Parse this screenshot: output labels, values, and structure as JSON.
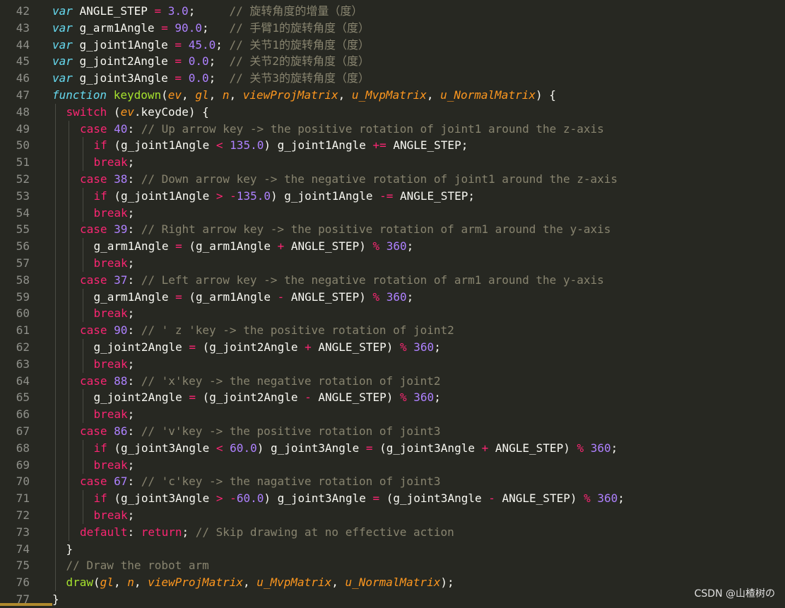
{
  "editor": {
    "lines": [
      {
        "n": "42",
        "indent": 0,
        "tokens": [
          [
            "kw",
            "var"
          ],
          [
            "var",
            " ANGLE_STEP "
          ],
          [
            "op",
            "="
          ],
          [
            "var",
            " "
          ],
          [
            "num",
            "3.0"
          ],
          [
            "var",
            ";     "
          ],
          [
            "cm",
            "// 旋转角度的增量（度）"
          ]
        ]
      },
      {
        "n": "43",
        "indent": 0,
        "tokens": [
          [
            "kw",
            "var"
          ],
          [
            "var",
            " g_arm1Angle "
          ],
          [
            "op",
            "="
          ],
          [
            "var",
            " "
          ],
          [
            "num",
            "90.0"
          ],
          [
            "var",
            ";   "
          ],
          [
            "cm",
            "// 手臂1的旋转角度（度）"
          ]
        ]
      },
      {
        "n": "44",
        "indent": 0,
        "tokens": [
          [
            "kw",
            "var"
          ],
          [
            "var",
            " g_joint1Angle "
          ],
          [
            "op",
            "="
          ],
          [
            "var",
            " "
          ],
          [
            "num",
            "45.0"
          ],
          [
            "var",
            "; "
          ],
          [
            "cm",
            "// 关节1的旋转角度（度）"
          ]
        ]
      },
      {
        "n": "45",
        "indent": 0,
        "tokens": [
          [
            "kw",
            "var"
          ],
          [
            "var",
            " g_joint2Angle "
          ],
          [
            "op",
            "="
          ],
          [
            "var",
            " "
          ],
          [
            "num",
            "0.0"
          ],
          [
            "var",
            ";  "
          ],
          [
            "cm",
            "// 关节2的旋转角度（度）"
          ]
        ]
      },
      {
        "n": "46",
        "indent": 0,
        "tokens": [
          [
            "kw",
            "var"
          ],
          [
            "var",
            " g_joint3Angle "
          ],
          [
            "op",
            "="
          ],
          [
            "var",
            " "
          ],
          [
            "num",
            "0.0"
          ],
          [
            "var",
            ";  "
          ],
          [
            "cm",
            "// 关节3的旋转角度（度）"
          ]
        ]
      },
      {
        "n": "47",
        "indent": 0,
        "tokens": [
          [
            "kw",
            "function"
          ],
          [
            "var",
            " "
          ],
          [
            "fn",
            "keydown"
          ],
          [
            "var",
            "("
          ],
          [
            "param",
            "ev"
          ],
          [
            "var",
            ", "
          ],
          [
            "param",
            "gl"
          ],
          [
            "var",
            ", "
          ],
          [
            "param",
            "n"
          ],
          [
            "var",
            ", "
          ],
          [
            "param",
            "viewProjMatrix"
          ],
          [
            "var",
            ", "
          ],
          [
            "param",
            "u_MvpMatrix"
          ],
          [
            "var",
            ", "
          ],
          [
            "param",
            "u_NormalMatrix"
          ],
          [
            "var",
            ") {"
          ]
        ]
      },
      {
        "n": "48",
        "indent": 1,
        "tokens": [
          [
            "kw2",
            "switch"
          ],
          [
            "var",
            " ("
          ],
          [
            "param",
            "ev"
          ],
          [
            "var",
            ".keyCode) {"
          ]
        ]
      },
      {
        "n": "49",
        "indent": 2,
        "tokens": [
          [
            "kw2",
            "case"
          ],
          [
            "var",
            " "
          ],
          [
            "num",
            "40"
          ],
          [
            "var",
            ": "
          ],
          [
            "cm",
            "// Up arrow key -> the positive rotation of joint1 around the z-axis"
          ]
        ]
      },
      {
        "n": "50",
        "indent": 3,
        "tokens": [
          [
            "kw2",
            "if"
          ],
          [
            "var",
            " (g_joint1Angle "
          ],
          [
            "op",
            "<"
          ],
          [
            "var",
            " "
          ],
          [
            "num",
            "135.0"
          ],
          [
            "var",
            ") g_joint1Angle "
          ],
          [
            "op",
            "+="
          ],
          [
            "var",
            " ANGLE_STEP;"
          ]
        ]
      },
      {
        "n": "51",
        "indent": 3,
        "tokens": [
          [
            "kw2",
            "break"
          ],
          [
            "var",
            ";"
          ]
        ]
      },
      {
        "n": "52",
        "indent": 2,
        "tokens": [
          [
            "kw2",
            "case"
          ],
          [
            "var",
            " "
          ],
          [
            "num",
            "38"
          ],
          [
            "var",
            ": "
          ],
          [
            "cm",
            "// Down arrow key -> the negative rotation of joint1 around the z-axis"
          ]
        ]
      },
      {
        "n": "53",
        "indent": 3,
        "tokens": [
          [
            "kw2",
            "if"
          ],
          [
            "var",
            " (g_joint1Angle "
          ],
          [
            "op",
            ">"
          ],
          [
            "var",
            " "
          ],
          [
            "op",
            "-"
          ],
          [
            "num",
            "135.0"
          ],
          [
            "var",
            ") g_joint1Angle "
          ],
          [
            "op",
            "-="
          ],
          [
            "var",
            " ANGLE_STEP;"
          ]
        ]
      },
      {
        "n": "54",
        "indent": 3,
        "tokens": [
          [
            "kw2",
            "break"
          ],
          [
            "var",
            ";"
          ]
        ]
      },
      {
        "n": "55",
        "indent": 2,
        "tokens": [
          [
            "kw2",
            "case"
          ],
          [
            "var",
            " "
          ],
          [
            "num",
            "39"
          ],
          [
            "var",
            ": "
          ],
          [
            "cm",
            "// Right arrow key -> the positive rotation of arm1 around the y-axis"
          ]
        ]
      },
      {
        "n": "56",
        "indent": 3,
        "tokens": [
          [
            "var",
            "g_arm1Angle "
          ],
          [
            "op",
            "="
          ],
          [
            "var",
            " (g_arm1Angle "
          ],
          [
            "op",
            "+"
          ],
          [
            "var",
            " ANGLE_STEP) "
          ],
          [
            "op",
            "%"
          ],
          [
            "var",
            " "
          ],
          [
            "num",
            "360"
          ],
          [
            "var",
            ";"
          ]
        ]
      },
      {
        "n": "57",
        "indent": 3,
        "tokens": [
          [
            "kw2",
            "break"
          ],
          [
            "var",
            ";"
          ]
        ]
      },
      {
        "n": "58",
        "indent": 2,
        "tokens": [
          [
            "kw2",
            "case"
          ],
          [
            "var",
            " "
          ],
          [
            "num",
            "37"
          ],
          [
            "var",
            ": "
          ],
          [
            "cm",
            "// Left arrow key -> the negative rotation of arm1 around the y-axis"
          ]
        ]
      },
      {
        "n": "59",
        "indent": 3,
        "tokens": [
          [
            "var",
            "g_arm1Angle "
          ],
          [
            "op",
            "="
          ],
          [
            "var",
            " (g_arm1Angle "
          ],
          [
            "op",
            "-"
          ],
          [
            "var",
            " ANGLE_STEP) "
          ],
          [
            "op",
            "%"
          ],
          [
            "var",
            " "
          ],
          [
            "num",
            "360"
          ],
          [
            "var",
            ";"
          ]
        ]
      },
      {
        "n": "60",
        "indent": 3,
        "tokens": [
          [
            "kw2",
            "break"
          ],
          [
            "var",
            ";"
          ]
        ]
      },
      {
        "n": "61",
        "indent": 2,
        "tokens": [
          [
            "kw2",
            "case"
          ],
          [
            "var",
            " "
          ],
          [
            "num",
            "90"
          ],
          [
            "var",
            ": "
          ],
          [
            "cm",
            "// ' z 'key -> the positive rotation of joint2"
          ]
        ]
      },
      {
        "n": "62",
        "indent": 3,
        "tokens": [
          [
            "var",
            "g_joint2Angle "
          ],
          [
            "op",
            "="
          ],
          [
            "var",
            " (g_joint2Angle "
          ],
          [
            "op",
            "+"
          ],
          [
            "var",
            " ANGLE_STEP) "
          ],
          [
            "op",
            "%"
          ],
          [
            "var",
            " "
          ],
          [
            "num",
            "360"
          ],
          [
            "var",
            ";"
          ]
        ]
      },
      {
        "n": "63",
        "indent": 3,
        "tokens": [
          [
            "kw2",
            "break"
          ],
          [
            "var",
            ";"
          ]
        ]
      },
      {
        "n": "64",
        "indent": 2,
        "tokens": [
          [
            "kw2",
            "case"
          ],
          [
            "var",
            " "
          ],
          [
            "num",
            "88"
          ],
          [
            "var",
            ": "
          ],
          [
            "cm",
            "// 'x'key -> the negative rotation of joint2"
          ]
        ]
      },
      {
        "n": "65",
        "indent": 3,
        "tokens": [
          [
            "var",
            "g_joint2Angle "
          ],
          [
            "op",
            "="
          ],
          [
            "var",
            " (g_joint2Angle "
          ],
          [
            "op",
            "-"
          ],
          [
            "var",
            " ANGLE_STEP) "
          ],
          [
            "op",
            "%"
          ],
          [
            "var",
            " "
          ],
          [
            "num",
            "360"
          ],
          [
            "var",
            ";"
          ]
        ]
      },
      {
        "n": "66",
        "indent": 3,
        "tokens": [
          [
            "kw2",
            "break"
          ],
          [
            "var",
            ";"
          ]
        ]
      },
      {
        "n": "67",
        "indent": 2,
        "tokens": [
          [
            "kw2",
            "case"
          ],
          [
            "var",
            " "
          ],
          [
            "num",
            "86"
          ],
          [
            "var",
            ": "
          ],
          [
            "cm",
            "// 'v'key -> the positive rotation of joint3"
          ]
        ]
      },
      {
        "n": "68",
        "indent": 3,
        "tokens": [
          [
            "kw2",
            "if"
          ],
          [
            "var",
            " (g_joint3Angle "
          ],
          [
            "op",
            "<"
          ],
          [
            "var",
            " "
          ],
          [
            "num",
            "60.0"
          ],
          [
            "var",
            ") g_joint3Angle "
          ],
          [
            "op",
            "="
          ],
          [
            "var",
            " (g_joint3Angle "
          ],
          [
            "op",
            "+"
          ],
          [
            "var",
            " ANGLE_STEP) "
          ],
          [
            "op",
            "%"
          ],
          [
            "var",
            " "
          ],
          [
            "num",
            "360"
          ],
          [
            "var",
            ";"
          ]
        ]
      },
      {
        "n": "69",
        "indent": 3,
        "tokens": [
          [
            "kw2",
            "break"
          ],
          [
            "var",
            ";"
          ]
        ]
      },
      {
        "n": "70",
        "indent": 2,
        "tokens": [
          [
            "kw2",
            "case"
          ],
          [
            "var",
            " "
          ],
          [
            "num",
            "67"
          ],
          [
            "var",
            ": "
          ],
          [
            "cm",
            "// 'c'key -> the nagative rotation of joint3"
          ]
        ]
      },
      {
        "n": "71",
        "indent": 3,
        "tokens": [
          [
            "kw2",
            "if"
          ],
          [
            "var",
            " (g_joint3Angle "
          ],
          [
            "op",
            ">"
          ],
          [
            "var",
            " "
          ],
          [
            "op",
            "-"
          ],
          [
            "num",
            "60.0"
          ],
          [
            "var",
            ") g_joint3Angle "
          ],
          [
            "op",
            "="
          ],
          [
            "var",
            " (g_joint3Angle "
          ],
          [
            "op",
            "-"
          ],
          [
            "var",
            " ANGLE_STEP) "
          ],
          [
            "op",
            "%"
          ],
          [
            "var",
            " "
          ],
          [
            "num",
            "360"
          ],
          [
            "var",
            ";"
          ]
        ]
      },
      {
        "n": "72",
        "indent": 3,
        "tokens": [
          [
            "kw2",
            "break"
          ],
          [
            "var",
            ";"
          ]
        ]
      },
      {
        "n": "73",
        "indent": 2,
        "tokens": [
          [
            "kw2",
            "default"
          ],
          [
            "var",
            ": "
          ],
          [
            "kw2",
            "return"
          ],
          [
            "var",
            "; "
          ],
          [
            "cm",
            "// Skip drawing at no effective action"
          ]
        ]
      },
      {
        "n": "74",
        "indent": 1,
        "tokens": [
          [
            "var",
            "}"
          ]
        ]
      },
      {
        "n": "75",
        "indent": 1,
        "tokens": [
          [
            "cm",
            "// Draw the robot arm"
          ]
        ]
      },
      {
        "n": "76",
        "indent": 1,
        "tokens": [
          [
            "fn",
            "draw"
          ],
          [
            "var",
            "("
          ],
          [
            "param",
            "gl"
          ],
          [
            "var",
            ", "
          ],
          [
            "param",
            "n"
          ],
          [
            "var",
            ", "
          ],
          [
            "param",
            "viewProjMatrix"
          ],
          [
            "var",
            ", "
          ],
          [
            "param",
            "u_MvpMatrix"
          ],
          [
            "var",
            ", "
          ],
          [
            "param",
            "u_NormalMatrix"
          ],
          [
            "var",
            ");"
          ]
        ]
      },
      {
        "n": "77",
        "indent": 0,
        "tokens": [
          [
            "var",
            "}"
          ]
        ]
      }
    ]
  },
  "watermark": "CSDN @山楂树の"
}
